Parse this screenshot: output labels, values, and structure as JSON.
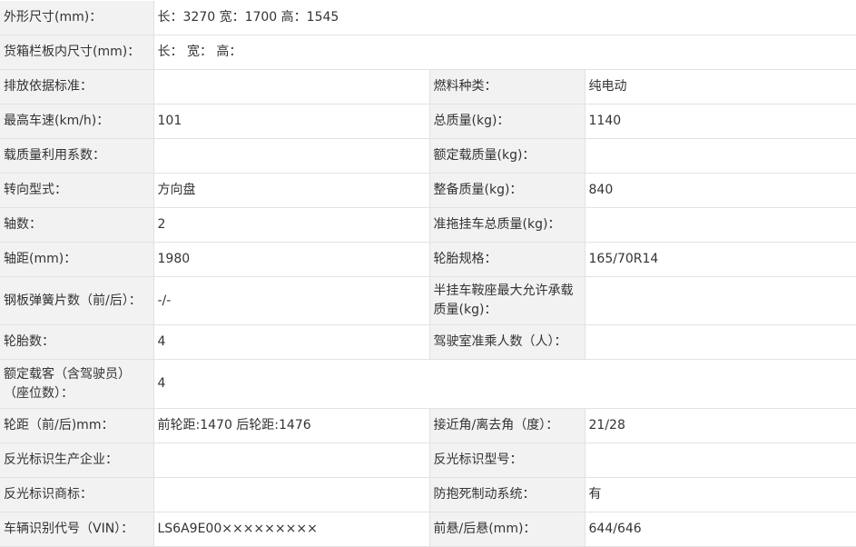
{
  "rows": [
    {
      "label": "外形尺寸(mm)：",
      "value": "长：3270 宽：1700 高：1545"
    },
    {
      "label": "货箱栏板内尺寸(mm)：",
      "value": "长： 宽： 高："
    },
    {
      "label": "排放依据标准：",
      "value": "",
      "label2": "燃料种类：",
      "value2": "纯电动"
    },
    {
      "label": "最高车速(km/h)：",
      "value": "101",
      "label2": "总质量(kg)：",
      "value2": "1140"
    },
    {
      "label": "载质量利用系数：",
      "value": "",
      "label2": "额定载质量(kg)：",
      "value2": ""
    },
    {
      "label": "转向型式：",
      "value": "方向盘",
      "label2": "整备质量(kg)：",
      "value2": "840"
    },
    {
      "label": "轴数：",
      "value": "2",
      "label2": "准拖挂车总质量(kg)：",
      "value2": ""
    },
    {
      "label": "轴距(mm)：",
      "value": "1980",
      "label2": "轮胎规格：",
      "value2": "165/70R14"
    },
    {
      "label": "钢板弹簧片数（前/后）：",
      "value": "-/-",
      "label2": "半挂车鞍座最大允许承载质量(kg)：",
      "value2": ""
    },
    {
      "label": "轮胎数：",
      "value": "4",
      "label2": "驾驶室准乘人数（人）：",
      "value2": ""
    },
    {
      "label": "额定载客（含驾驶员）（座位数）：",
      "value": "4"
    },
    {
      "label": "轮距（前/后)mm：",
      "value": "前轮距:1470 后轮距:1476",
      "label2": "接近角/离去角（度）：",
      "value2": "21/28"
    },
    {
      "label": "反光标识生产企业：",
      "value": "",
      "label2": "反光标识型号：",
      "value2": ""
    },
    {
      "label": "反光标识商标：",
      "value": "",
      "label2": "防抱死制动系统：",
      "value2": "有"
    },
    {
      "label": "车辆识别代号（VIN）：",
      "value": "LS6A9E00×××××××××",
      "label2": "前悬/后悬(mm)：",
      "value2": "644/646"
    }
  ]
}
